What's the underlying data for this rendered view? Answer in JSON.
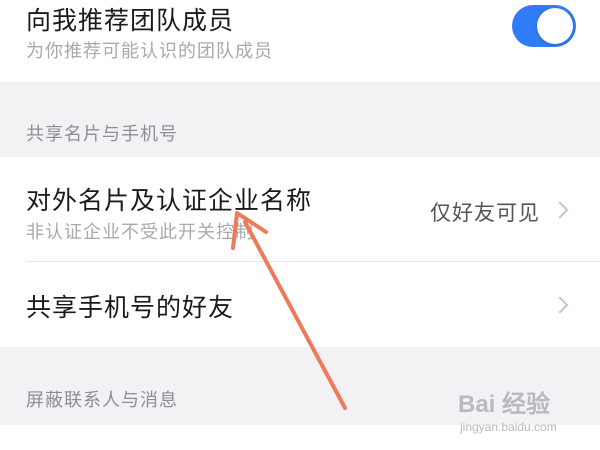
{
  "recommend": {
    "title": "向我推荐团队成员",
    "subtitle": "为你推荐可能认识的团队成员",
    "toggle_on": true,
    "toggle_color": "#2f7cf6"
  },
  "sections": {
    "share_header": "共享名片与手机号",
    "block_header": "屏蔽联系人与消息"
  },
  "card_row": {
    "title": "对外名片及认证企业名称",
    "subtitle": "非认证企业不受此开关控制",
    "value": "仅好友可见"
  },
  "phone_row": {
    "title": "共享手机号的好友"
  },
  "annotation": {
    "arrow_color": "#ee7a5a"
  },
  "watermark": {
    "main": "Bai 经验",
    "sub": "jingyan.baidu.com"
  }
}
